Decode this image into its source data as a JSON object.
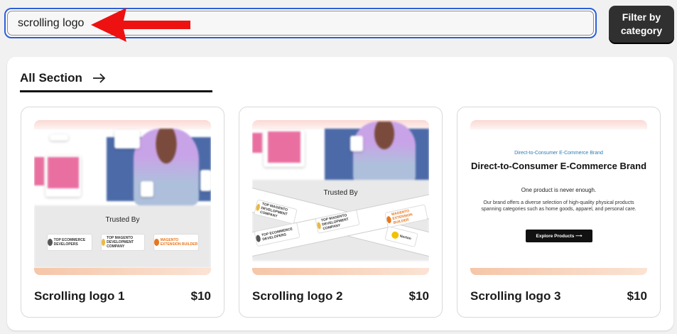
{
  "search": {
    "value": "scrolling logo",
    "placeholder": ""
  },
  "filter_button": {
    "line1": "Filter by",
    "line2": "category"
  },
  "section": {
    "title": "All Section"
  },
  "cards": [
    {
      "name": "Scrolling logo 1",
      "price": "$10",
      "preview": {
        "heading": "Trusted By",
        "badges": [
          "TOP ECOMMERCE DEVELOPERS",
          "TOP MAGENTO DEVELOPMENT COMPANY",
          "MAGENTO EXTENSION BUILDER"
        ]
      }
    },
    {
      "name": "Scrolling logo 2",
      "price": "$10",
      "preview": {
        "heading": "Trusted By",
        "badges": [
          "TOP MAGENTO DEVELOPMENT COMPANY",
          "MAGENTO EXTENSION BUILDER",
          "TOP ECOMMERCE DEVELOPERS",
          "TOP MAGENTO DEVELOPMENT COMPANY",
          "Norton"
        ]
      }
    },
    {
      "name": "Scrolling logo 3",
      "price": "$10",
      "preview": {
        "kicker": "Direct-to-Consumer E-Commerce Brand",
        "title": "Direct-to-Consumer E-Commerce Brand",
        "subtitle": "One product is never enough.",
        "body": "Our brand offers a diverse selection of high-quality physical products spanning categories such as home goods, apparel, and personal care.",
        "button": "Explore Products"
      }
    }
  ],
  "colors": {
    "accent_blue": "#2b5fd9",
    "annotation_red": "#ee1111",
    "button_dark": "#303030"
  }
}
